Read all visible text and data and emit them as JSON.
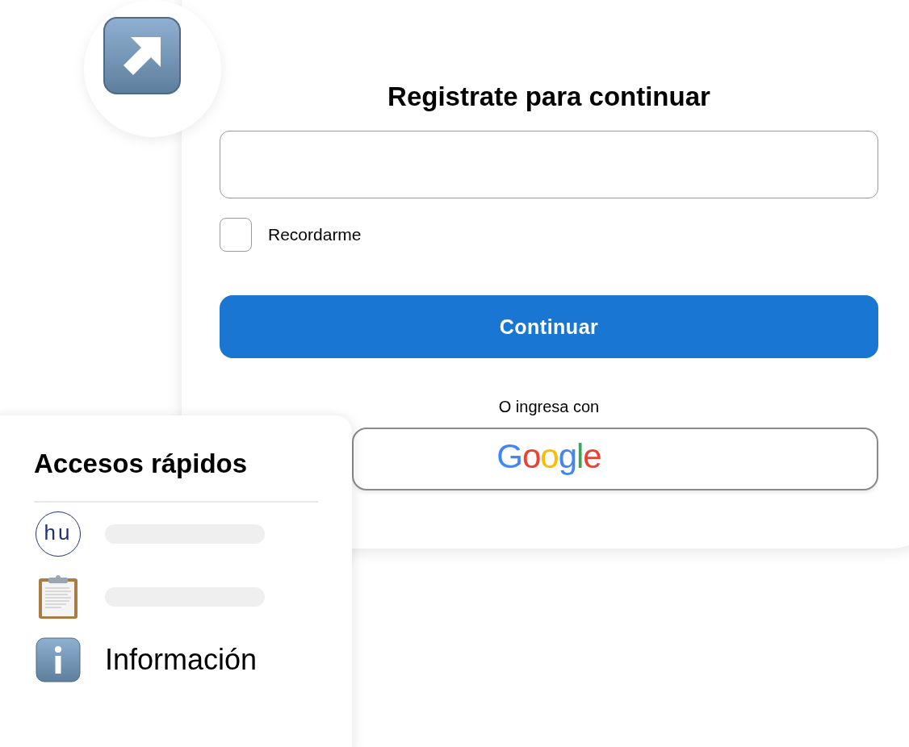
{
  "login_card": {
    "title": "Registrate para continuar",
    "remember": {
      "label": "Recordarme",
      "checked": false
    },
    "continue_button": "Continuar",
    "divider_text": "O ingresa con",
    "google_button": "Google"
  },
  "quick_access": {
    "title": "Accesos rápidos",
    "items": [
      {
        "kind": "logo",
        "logo_text": "hu"
      },
      {
        "kind": "clipboard"
      },
      {
        "kind": "info",
        "label": "Información"
      }
    ]
  }
}
